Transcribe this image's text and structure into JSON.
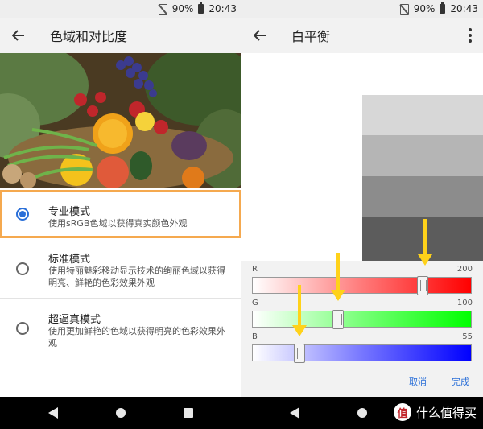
{
  "status": {
    "battery": "90%",
    "time": "20:43"
  },
  "left": {
    "title": "色域和对比度",
    "options": [
      {
        "title": "专业模式",
        "desc": "使用sRGB色域以获得真实颜色外观",
        "selected": true
      },
      {
        "title": "标准模式",
        "desc": "使用特丽魅彩移动显示技术的绚丽色域以获得明亮、鲜艳的色彩效果外观",
        "selected": false
      },
      {
        "title": "超逼真模式",
        "desc": "使用更加鲜艳的色域以获得明亮的色彩效果外观",
        "selected": false
      }
    ]
  },
  "right": {
    "title": "白平衡",
    "sliders": [
      {
        "label": "R",
        "value": "200",
        "level": 0.78,
        "color": "#ff0000"
      },
      {
        "label": "G",
        "value": "100",
        "level": 0.39,
        "color": "#00ff00"
      },
      {
        "label": "B",
        "value": "55",
        "level": 0.215,
        "color": "#0000ff"
      }
    ],
    "cancel": "取消",
    "done": "完成"
  },
  "highlight_color": "#f5a94f",
  "arrow_color": "#ffd21a",
  "watermark": {
    "logo": "值",
    "text": "什么值得买"
  },
  "icons": [
    "no-sim-icon",
    "battery-icon",
    "back-arrow-icon",
    "more-vert-icon",
    "nav-back-icon",
    "nav-home-icon",
    "nav-recents-icon"
  ]
}
